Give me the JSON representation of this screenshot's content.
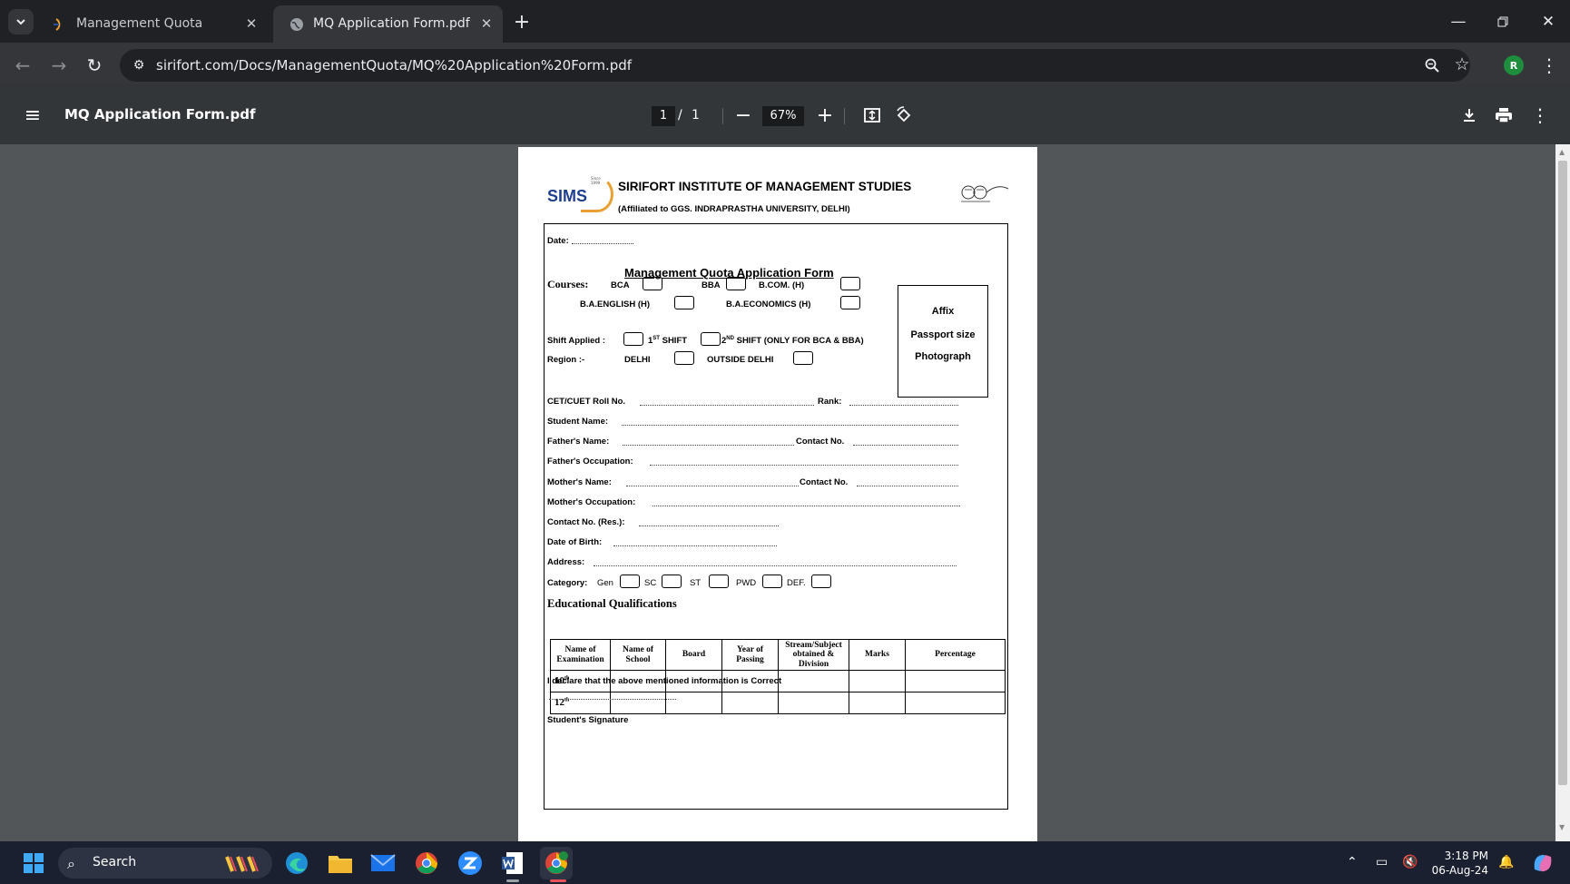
{
  "browser": {
    "tabs": [
      {
        "title": "Management Quota",
        "active": false
      },
      {
        "title": "MQ Application Form.pdf",
        "active": true
      }
    ],
    "url": "sirifort.com/Docs/ManagementQuota/MQ%20Application%20Form.pdf",
    "profile_initial": "R"
  },
  "pdf_toolbar": {
    "filename": "MQ Application Form.pdf",
    "current_page": "1",
    "page_separator": "/",
    "total_pages": "1",
    "zoom": "67%"
  },
  "document": {
    "logo_text": "SIMS",
    "logo_since": "Since 1999",
    "institute": "SIRIFORT INSTITUTE OF MANAGEMENT STUDIES",
    "affiliation": "(Affiliated to GGS. INDRAPRASTHA UNIVERSITY, DELHI)",
    "date_label": "Date:",
    "form_title": "Management Quota Application Form",
    "courses_label": "Courses:",
    "courses": {
      "bca": "BCA",
      "bba": "BBA",
      "bcom": "B.COM. (H)",
      "baeng": "B.A.ENGLISH (H)",
      "baeco": "B.A.ECONOMICS (H)"
    },
    "shift_label": "Shift Applied :",
    "shift1_num": "1",
    "shift1_sup": "ST",
    "shift1_text": "SHIFT",
    "shift2_num": "2",
    "shift2_sup": "ND",
    "shift2_text": "SHIFT (ONLY FOR BCA & BBA)",
    "region_label": "Region :-",
    "region_delhi": "DELHI",
    "region_outside": "OUTSIDE DELHI",
    "photo": {
      "line1": "Affix",
      "line2": "Passport size",
      "line3": "Photograph"
    },
    "fields": {
      "roll": "CET/CUET Roll No.",
      "rank": "Rank:",
      "student": "Student Name:",
      "father": "Father's Name:",
      "father_contact": "Contact No.",
      "father_occ": "Father's Occupation:",
      "mother": "Mother's Name:",
      "mother_contact": "Contact No.",
      "mother_occ": "Mother's Occupation:",
      "contact_res": "Contact No. (Res.):",
      "dob": "Date of Birth:",
      "address": "Address:"
    },
    "category_label": "Category:",
    "categories": {
      "gen": "Gen",
      "sc": "SC",
      "st": "ST",
      "pwd": "PWD",
      "def": "DEF."
    },
    "edu_heading": "Educational Qualifications",
    "edu_headers": [
      "Name of Examination",
      "Name of School",
      "Board",
      "Year of Passing",
      "Stream/Subject obtained & Division",
      "Marks",
      "Percentage"
    ],
    "edu_rows": [
      {
        "num": "10",
        "sup": "th"
      },
      {
        "num": "12",
        "sup": "th"
      }
    ],
    "declaration": "I declare that the above mentioned information is Correct",
    "signature": "Student's Signature"
  },
  "taskbar": {
    "search_placeholder": "Search",
    "time": "3:18 PM",
    "date": "06-Aug-24"
  }
}
